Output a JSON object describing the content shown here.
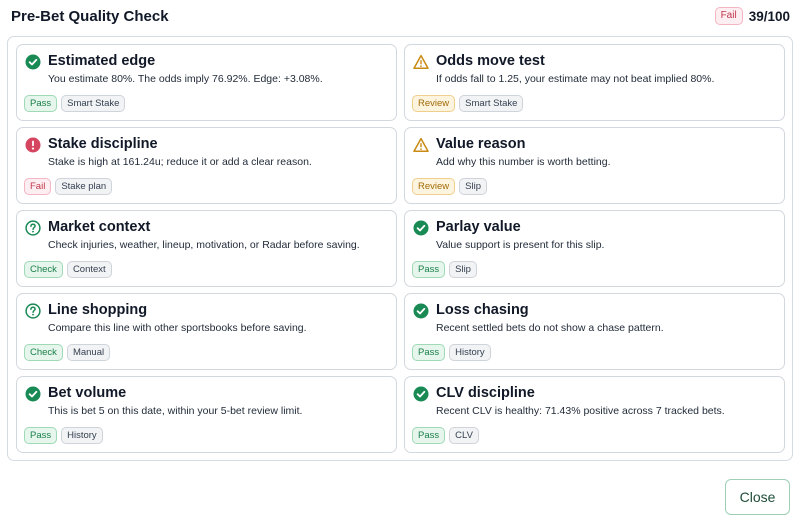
{
  "header": {
    "title": "Pre-Bet Quality Check",
    "score_badge": "Fail",
    "score": "39/100"
  },
  "checks": [
    {
      "icon": "check-circle-icon",
      "status": "pass",
      "title": "Estimated edge",
      "desc": "You estimate 80%. The odds imply 76.92%. Edge: +3.08%.",
      "status_label": "Pass",
      "source": "Smart Stake"
    },
    {
      "icon": "warning-triangle-icon",
      "status": "review",
      "title": "Odds move test",
      "desc": "If odds fall to 1.25, your estimate may not beat implied 80%.",
      "status_label": "Review",
      "source": "Smart Stake"
    },
    {
      "icon": "alert-circle-icon",
      "status": "fail",
      "title": "Stake discipline",
      "desc": "Stake is high at 161.24u; reduce it or add a clear reason.",
      "status_label": "Fail",
      "source": "Stake plan"
    },
    {
      "icon": "warning-triangle-icon",
      "status": "review",
      "title": "Value reason",
      "desc": "Add why this number is worth betting.",
      "status_label": "Review",
      "source": "Slip"
    },
    {
      "icon": "question-circle-icon",
      "status": "check",
      "title": "Market context",
      "desc": "Check injuries, weather, lineup, motivation, or Radar before saving.",
      "status_label": "Check",
      "source": "Context"
    },
    {
      "icon": "check-circle-icon",
      "status": "pass",
      "title": "Parlay value",
      "desc": "Value support is present for this slip.",
      "status_label": "Pass",
      "source": "Slip"
    },
    {
      "icon": "question-circle-icon",
      "status": "check",
      "title": "Line shopping",
      "desc": "Compare this line with other sportsbooks before saving.",
      "status_label": "Check",
      "source": "Manual"
    },
    {
      "icon": "check-circle-icon",
      "status": "pass",
      "title": "Loss chasing",
      "desc": "Recent settled bets do not show a chase pattern.",
      "status_label": "Pass",
      "source": "History"
    },
    {
      "icon": "check-circle-icon",
      "status": "pass",
      "title": "Bet volume",
      "desc": "This is bet 5 on this date, within your 5-bet review limit.",
      "status_label": "Pass",
      "source": "History"
    },
    {
      "icon": "check-circle-icon",
      "status": "pass",
      "title": "CLV discipline",
      "desc": "Recent CLV is healthy: 71.43% positive across 7 tracked bets.",
      "status_label": "Pass",
      "source": "CLV"
    }
  ],
  "footer": {
    "close_label": "Close"
  },
  "colors": {
    "pass": "#1a8a55",
    "fail": "#d64560",
    "review": "#c98a14",
    "check": "#1a8a55"
  }
}
